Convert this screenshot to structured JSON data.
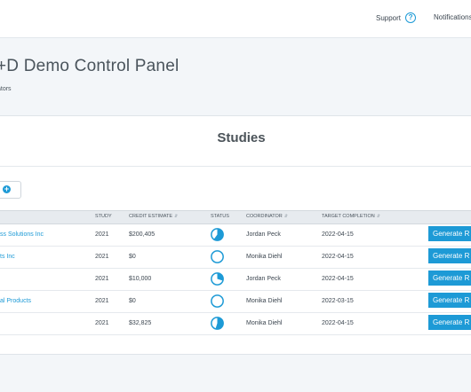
{
  "header": {
    "support_label": "Support",
    "help_glyph": "?",
    "notifications_label": "Notifications"
  },
  "page": {
    "title": "+D Demo Control Panel",
    "subnav": "ators"
  },
  "panel": {
    "title": "Studies",
    "add_glyph": "+"
  },
  "table": {
    "columns": [
      "Study",
      "Credit Estimate",
      "Status",
      "Coordinator",
      "Target Completion"
    ],
    "sort_glyph": "⇵",
    "rows": [
      {
        "name": "ss Solutions Inc",
        "study": "2021",
        "credit": "$200,405",
        "status_fraction": 0.6,
        "coordinator": "Jordan Peck",
        "target": "2022-04-15",
        "action": "Generate R"
      },
      {
        "name": "ts Inc",
        "study": "2021",
        "credit": "$0",
        "status_fraction": 0,
        "coordinator": "Monika Diehl",
        "target": "2022-04-15",
        "action": "Generate R"
      },
      {
        "name": "",
        "study": "2021",
        "credit": "$10,000",
        "status_fraction": 0.3,
        "coordinator": "Jordan Peck",
        "target": "2022-04-15",
        "action": "Generate R"
      },
      {
        "name": "al Products",
        "study": "2021",
        "credit": "$0",
        "status_fraction": 0,
        "coordinator": "Monika Diehl",
        "target": "2022-03-15",
        "action": "Generate R"
      },
      {
        "name": "",
        "study": "2021",
        "credit": "$32,825",
        "status_fraction": 0.55,
        "coordinator": "Monika Diehl",
        "target": "2022-04-15",
        "action": "Generate R"
      }
    ]
  },
  "colors": {
    "accent": "#1d9ad6"
  }
}
